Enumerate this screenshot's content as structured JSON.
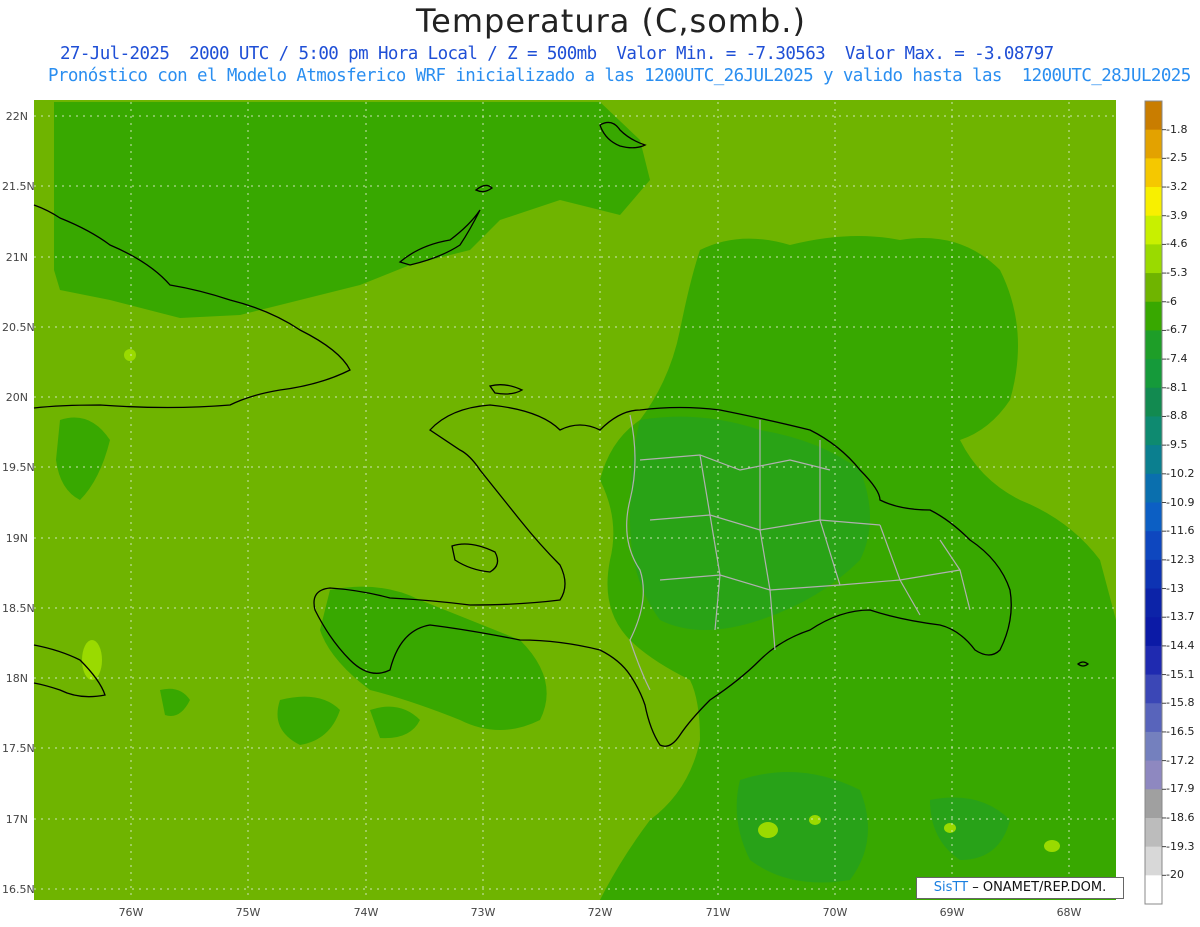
{
  "header": {
    "title": "Temperatura (C,somb.)",
    "line1": "27-Jul-2025  2000 UTC / 5:00 pm Hora Local / Z = 500mb  Valor Min. = -7.30563  Valor Max. = -3.08797",
    "line2": "Pronóstico con el Modelo Atmosferico WRF inicializado a las 1200UTC_26JUL2025 y valido hasta las  1200UTC_28JUL2025"
  },
  "axes": {
    "lat_labels": [
      "22N",
      "21.5N",
      "21N",
      "20.5N",
      "20N",
      "19.5N",
      "19N",
      "18.5N",
      "18N",
      "17.5N",
      "17N",
      "16.5N"
    ],
    "lon_labels": [
      "76W",
      "75W",
      "74W",
      "73W",
      "72W",
      "71W",
      "70W",
      "69W",
      "68W"
    ]
  },
  "colorbar": {
    "labels": [
      "-1.8",
      "-2.5",
      "-3.2",
      "-3.9",
      "-4.6",
      "-5.3",
      "-6",
      "-6.7",
      "-7.4",
      "-8.1",
      "-8.8",
      "-9.5",
      "-10.2",
      "-10.9",
      "-11.6",
      "-12.3",
      "-13",
      "-13.7",
      "-14.4",
      "-15.1",
      "-15.8",
      "-16.5",
      "-17.2",
      "-17.9",
      "-18.6",
      "-19.3",
      "-20"
    ],
    "colors": [
      "#c97d00",
      "#e3a200",
      "#f5c800",
      "#f8f000",
      "#c8f000",
      "#9ada00",
      "#6fb400",
      "#38a800",
      "#1e9e28",
      "#159a3a",
      "#128a50",
      "#0e8a70",
      "#0b7f8f",
      "#0a6fae",
      "#0c5fc4",
      "#0e47bf",
      "#0d33b3",
      "#0c23a8",
      "#0b1aa6",
      "#1f2ab0",
      "#3b47b6",
      "#5864bb",
      "#7480be",
      "#8e88c0",
      "#a0a0a0",
      "#bcbcbc",
      "#d8d8d8",
      "#ffffff"
    ]
  },
  "map_colors": {
    "base": "#6fb400",
    "medium": "#38a800",
    "dark": "#1e9e28",
    "light": "#9ada00",
    "grid": "#cfe8c0",
    "coast": "#000000",
    "border": "#b0b0b0"
  },
  "credit": {
    "brand": "SisTT",
    "text": "– ONAMET/REP.DOM."
  }
}
